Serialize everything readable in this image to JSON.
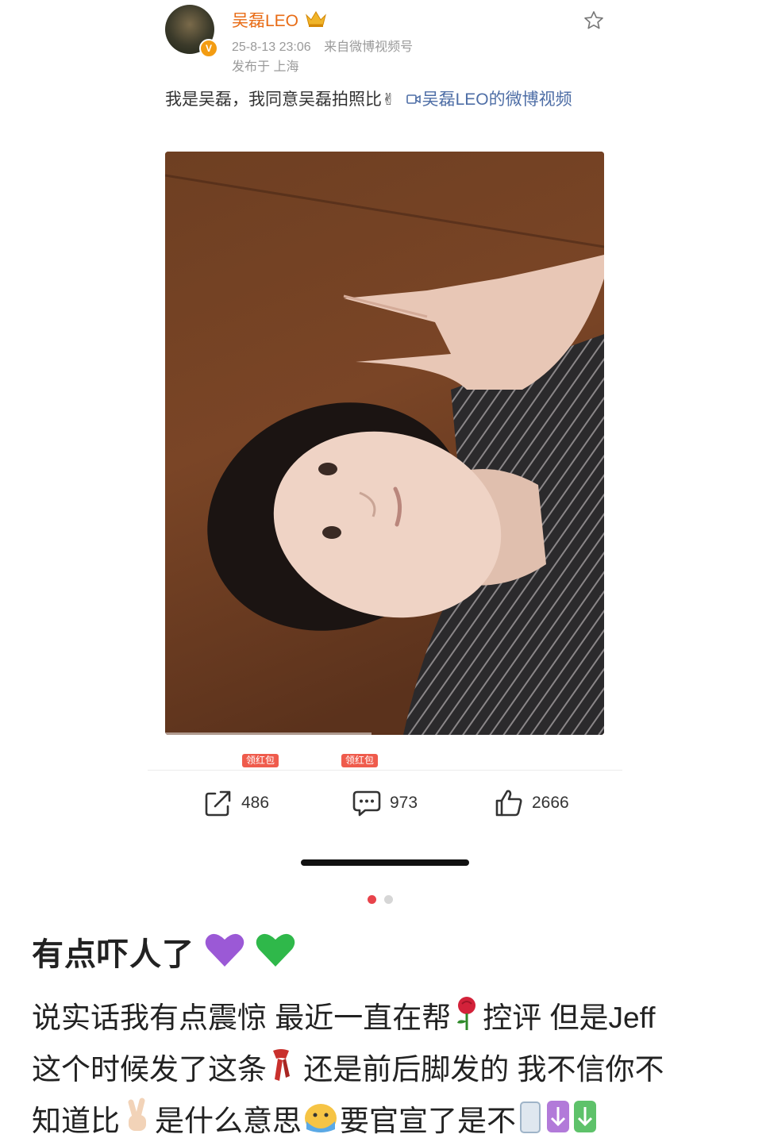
{
  "post": {
    "author": "吴磊LEO",
    "timestamp": "25-8-13 23:06",
    "source": "来自微博视频号",
    "location": "发布于 上海",
    "text": "我是吴磊，我同意吴磊拍照比",
    "video_link": "吴磊LEO的微博视频",
    "emojis": {
      "victory": "✌"
    },
    "redpack_badges": [
      "领红包",
      "领红包"
    ],
    "actions": {
      "share_count": "486",
      "comment_count": "973",
      "like_count": "2666"
    }
  },
  "pager": {
    "active_dot": 1,
    "total_dots": 2
  },
  "caption": {
    "title": "有点吓人了",
    "line1a": "说实话我有点震惊 最近一直在帮",
    "line1b": "控评 但是Jeff",
    "line2a": "这个时候发了这条",
    "line2b": " 还是前后脚发的 我不信你不",
    "line3a": "知道比",
    "line3b": "是什么意思",
    "line3c": "要官宣了是不"
  },
  "colors": {
    "author": "#e86c16",
    "link": "#4e6ea6",
    "meta": "#9a9a9a",
    "redpack": "#ef5b4c",
    "dot_active": "#e8434b",
    "dot_inactive": "#d6d6d6",
    "heart_purple": "#9b59d6",
    "heart_green": "#2fb84a"
  }
}
